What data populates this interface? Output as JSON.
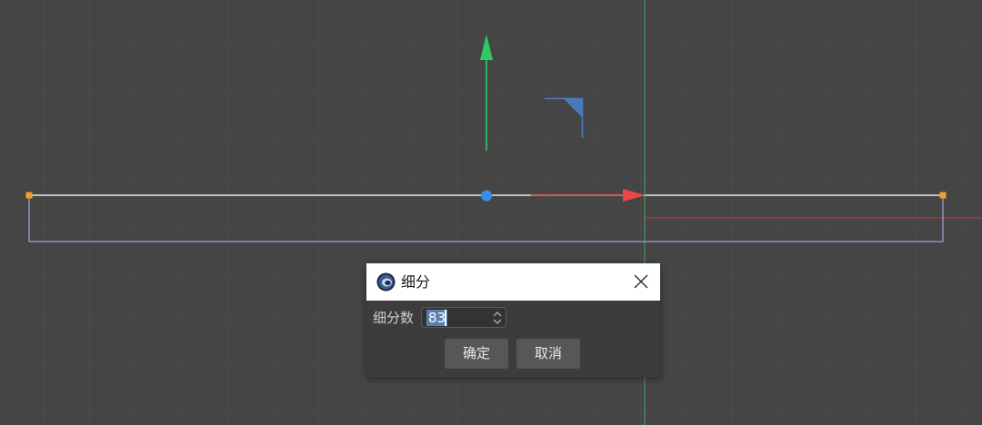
{
  "colors": {
    "viewport_background": "#454545",
    "grid": "#505050",
    "y_axis_handle": "#2ecc5f",
    "x_axis_handle": "#e84848",
    "plane_handle": "#4a7ab8",
    "pivot": "#3a8ee6",
    "edge": "#e6e6e6",
    "outline": "#9aa4c8",
    "point": "#f0a030",
    "world_y_axis": "#3fbf6f",
    "world_x_axis": "#c84040"
  },
  "icons": {
    "app": "cinema4d-logo-icon",
    "close": "close-icon",
    "spinner": "spinner-arrows-icon"
  },
  "dialog": {
    "title": "细分",
    "field_label": "细分数",
    "field_value": "83",
    "ok_label": "确定",
    "cancel_label": "取消"
  }
}
